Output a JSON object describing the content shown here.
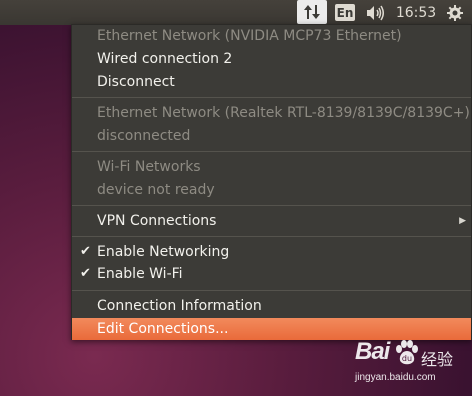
{
  "panel": {
    "network_icon": "arrows-up-down-icon",
    "language": "En",
    "volume_icon": "speaker-icon",
    "clock": "16:53",
    "settings_icon": "gear-icon"
  },
  "menu": {
    "ethernet1_header": "Ethernet Network (NVIDIA MCP73 Ethernet)",
    "wired_connection": "Wired connection 2",
    "disconnect": "Disconnect",
    "ethernet2_header": "Ethernet Network (Realtek RTL-8139/8139C/8139C+)",
    "ethernet2_status": "disconnected",
    "wifi_header": "Wi-Fi Networks",
    "wifi_status": "device not ready",
    "vpn": "VPN Connections",
    "enable_networking": "Enable Networking",
    "enable_wifi": "Enable Wi-Fi",
    "connection_info": "Connection Information",
    "edit_connections": "Edit Connections..."
  },
  "watermark": {
    "logo_left": "Bai",
    "logo_right": "经验",
    "url": "jingyan.baidu.com"
  },
  "colors": {
    "highlight": "#e96a3a",
    "menu_bg": "#3c3b37",
    "panel_bg": "#3c3b37"
  }
}
